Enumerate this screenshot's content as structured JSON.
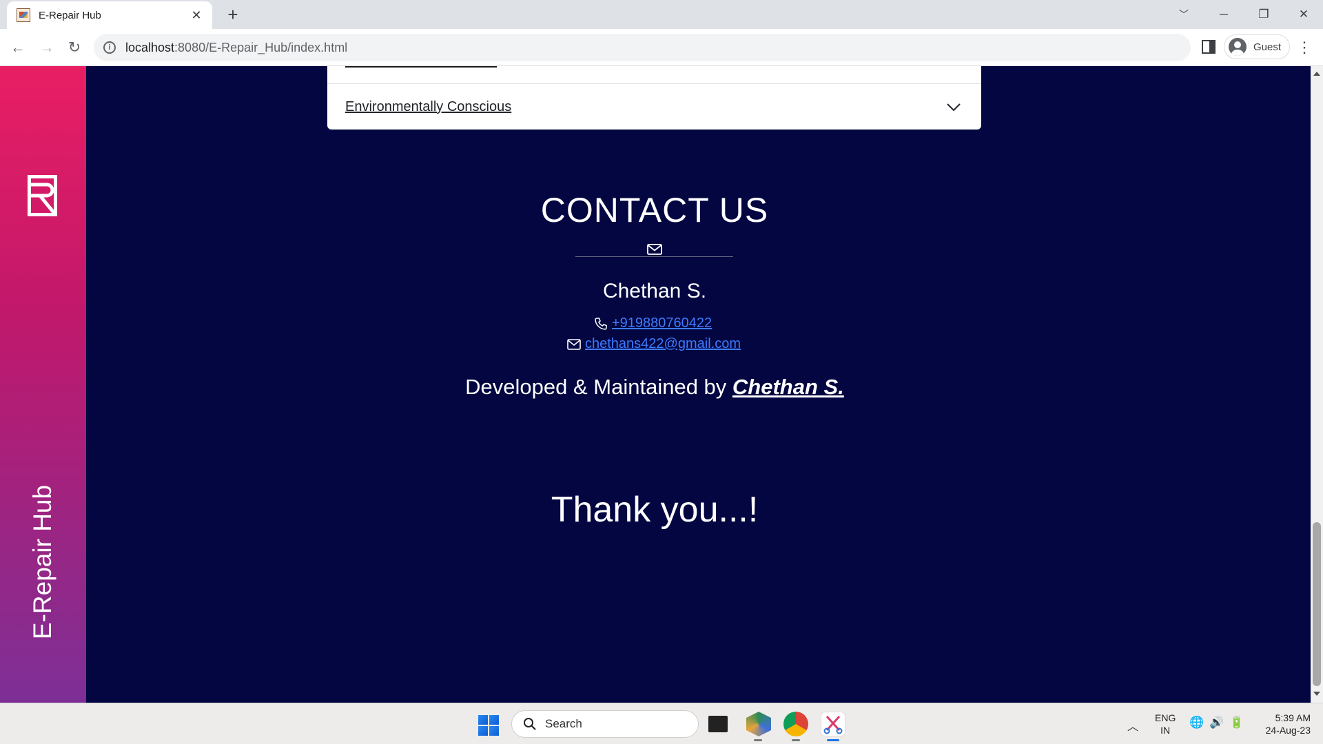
{
  "browser": {
    "tab_title": "E-Repair Hub",
    "url_host": "localhost",
    "url_rest": ":8080/E-Repair_Hub/index.html",
    "profile_label": "Guest"
  },
  "sidebar": {
    "brand_text": "E-Repair Hub"
  },
  "accordion": {
    "item_title": "Environmentally Conscious"
  },
  "contact": {
    "title": "CONTACT US",
    "name": "Chethan S.",
    "phone": "+919880760422",
    "email": "chethans422@gmail.com",
    "credit_prefix": "Developed & Maintained by ",
    "credit_name": "Chethan S."
  },
  "closing": {
    "thanks": "Thank you...!"
  },
  "taskbar": {
    "search_label": "Search",
    "lang_line1": "ENG",
    "lang_line2": "IN",
    "time": "5:39 AM",
    "date": "24-Aug-23"
  },
  "colors": {
    "page_background": "#030640",
    "sidebar_gradient_top": "#e91e63",
    "sidebar_gradient_bottom": "#7d2f96",
    "link": "#3d7bff"
  }
}
